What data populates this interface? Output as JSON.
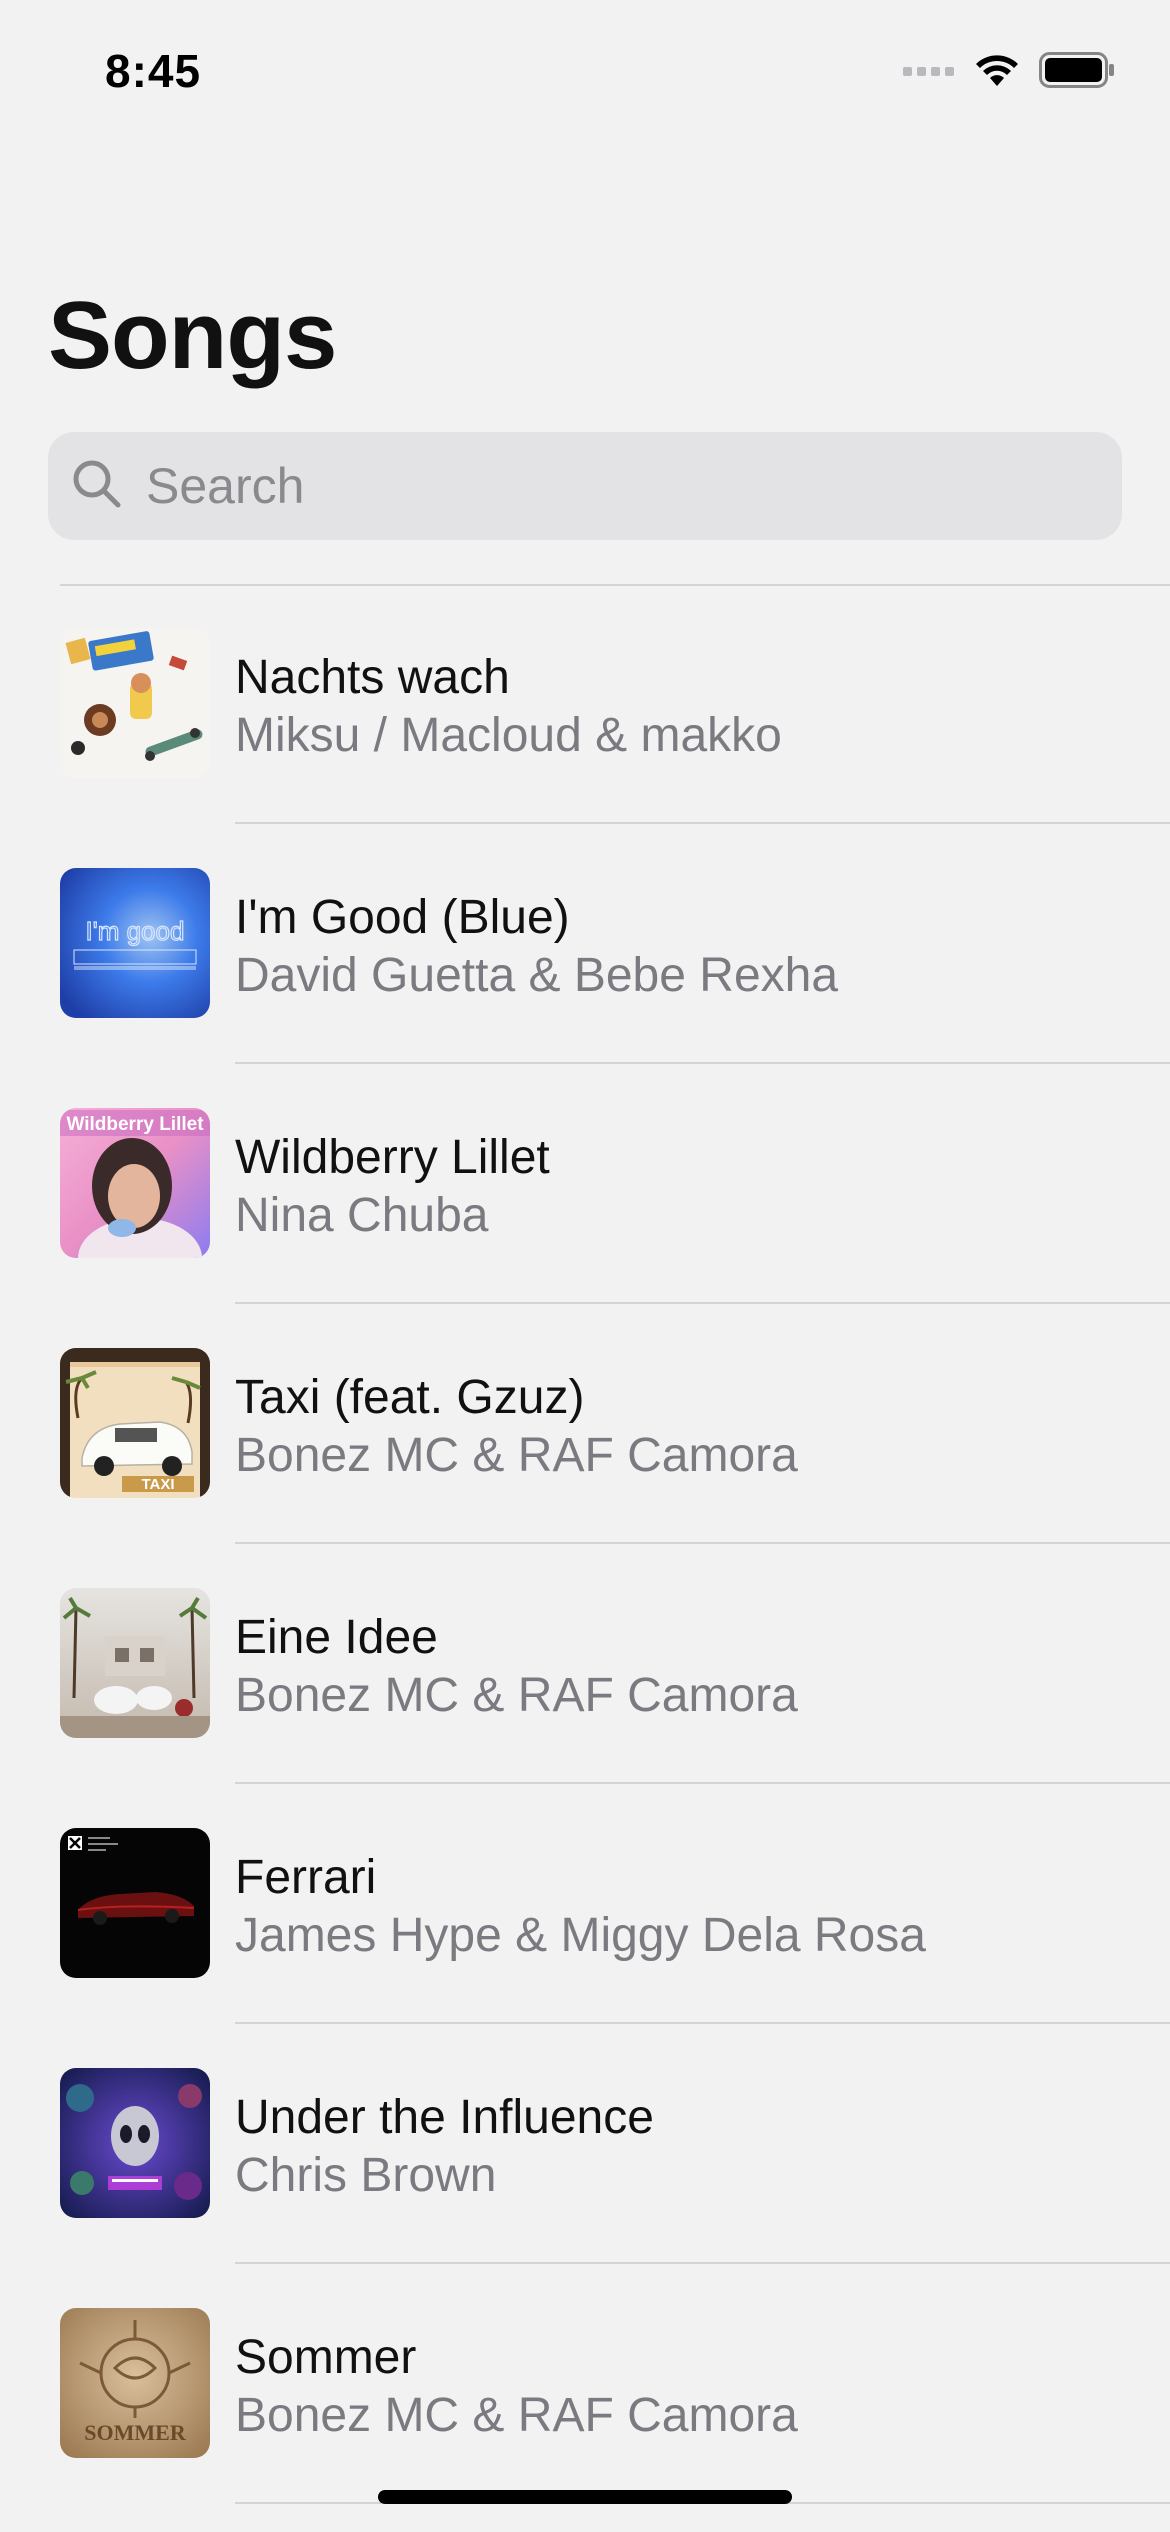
{
  "status_bar": {
    "time": "8:45",
    "icons": [
      "cellular-signal-icon",
      "wifi-icon",
      "battery-icon"
    ]
  },
  "header": {
    "title": "Songs"
  },
  "search": {
    "placeholder": "Search",
    "value": ""
  },
  "songs": [
    {
      "title": "Nachts wach",
      "artist": "Miksu / Macloud & makko",
      "artwork": "nachts-wach-artwork"
    },
    {
      "title": "I'm Good (Blue)",
      "artist": "David Guetta & Bebe Rexha",
      "artwork": "im-good-blue-artwork"
    },
    {
      "title": "Wildberry Lillet",
      "artist": "Nina Chuba",
      "artwork": "wildberry-lillet-artwork"
    },
    {
      "title": "Taxi (feat. Gzuz)",
      "artist": "Bonez MC & RAF Camora",
      "artwork": "taxi-artwork"
    },
    {
      "title": "Eine Idee",
      "artist": "Bonez MC & RAF Camora",
      "artwork": "eine-idee-artwork"
    },
    {
      "title": "Ferrari",
      "artist": "James Hype & Miggy Dela Rosa",
      "artwork": "ferrari-artwork"
    },
    {
      "title": "Under the Influence",
      "artist": "Chris Brown",
      "artwork": "under-the-influence-artwork"
    },
    {
      "title": "Sommer",
      "artist": "Bonez MC & RAF Camora",
      "artwork": "sommer-artwork"
    }
  ],
  "artwork_text": {
    "im_good": "I'm good",
    "wildberry": "Wildberry Lillet",
    "taxi": "TAXI",
    "sommer": "SOMMER"
  },
  "colors": {
    "background": "#f2f2f3",
    "search_fill": "#e3e3e5",
    "secondary_text": "#7a7a80",
    "divider": "#d4d4d7"
  }
}
